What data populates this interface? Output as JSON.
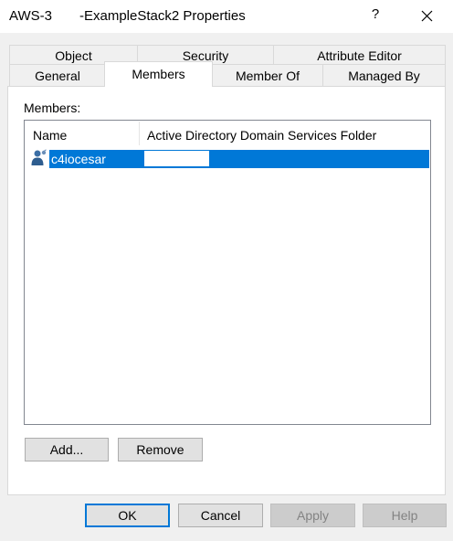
{
  "window": {
    "title": "AWS-3          -ExampleStack2 Properties",
    "help_glyph": "?",
    "close_icon": "close-icon"
  },
  "tabs": {
    "row1": [
      {
        "label": "Object"
      },
      {
        "label": "Security"
      },
      {
        "label": "Attribute Editor"
      }
    ],
    "row2": [
      {
        "label": "General"
      },
      {
        "label": "Members"
      },
      {
        "label": "Member Of"
      },
      {
        "label": "Managed By"
      }
    ],
    "active": "Members"
  },
  "members_panel": {
    "label": "Members:",
    "columns": [
      "Name",
      "Active Directory Domain Services Folder"
    ],
    "rows": [
      {
        "name": "c4iocesar",
        "folder": "",
        "icon": "user-icon",
        "selected": true
      }
    ]
  },
  "actions": {
    "add": "Add...",
    "remove": "Remove"
  },
  "dialog_buttons": {
    "ok": "OK",
    "cancel": "Cancel",
    "apply": "Apply",
    "help": "Help"
  },
  "colors": {
    "selection": "#0078d7",
    "default_button_border": "#0078d7",
    "disabled_text": "#838383"
  }
}
